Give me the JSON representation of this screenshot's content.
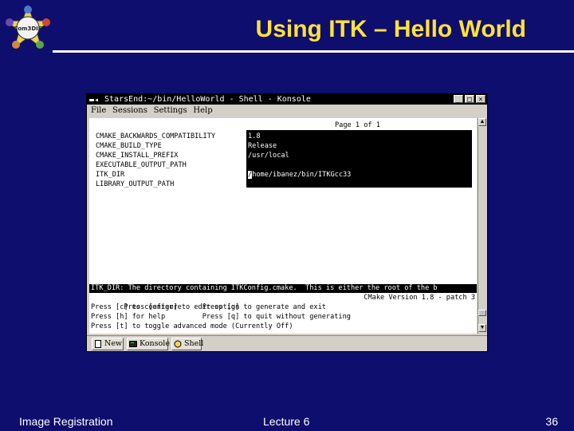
{
  "slide": {
    "title": "Using ITK – Hello World",
    "footer_left": "Image Registration",
    "footer_center": "Lecture 6",
    "footer_right": "36"
  },
  "logo": {
    "text": "Com3DIS"
  },
  "window": {
    "titlebar": "StarsEnd:~/bin/HelloWorld - Shell - Konsole",
    "buttons": [
      "_",
      "□",
      "×"
    ],
    "menu": [
      "File",
      "Sessions",
      "Settings",
      "Help"
    ]
  },
  "terminal": {
    "page_indicator": "Page 1 of 1",
    "variables": [
      "CMAKE_BACKWARDS_COMPATIBILITY",
      "CMAKE_BUILD_TYPE",
      "CMAKE_INSTALL_PREFIX",
      "EXECUTABLE_OUTPUT_PATH",
      "ITK_DIR",
      "LIBRARY_OUTPUT_PATH"
    ],
    "values": [
      "1.8",
      "Release",
      "/usr/local",
      "",
      "/home/ibanez/bin/ITKGcc33",
      ""
    ],
    "status_line": "ITK_DIR: The directory containing ITKConfig.cmake.  This is either the root of the b",
    "help": [
      {
        "left": "Press [enter] to edit option",
        "right": "CMake Version 1.8 - patch 3"
      },
      {
        "left": "Press [c] to configure     Press [g] to generate and exit",
        "right": ""
      },
      {
        "left": "Press [h] for help         Press [q] to quit without generating",
        "right": ""
      },
      {
        "left": "Press [t] to toggle advanced mode (Currently Off)",
        "right": ""
      }
    ]
  },
  "tabs": [
    {
      "label": "New",
      "icon": "new-session-icon"
    },
    {
      "label": "Konsole",
      "icon": "konsole-icon"
    },
    {
      "label": "Shell",
      "icon": "shell-icon"
    }
  ],
  "colors": {
    "background": "#0e0e6e",
    "title": "#ffe23a",
    "footer": "#ffffff"
  }
}
